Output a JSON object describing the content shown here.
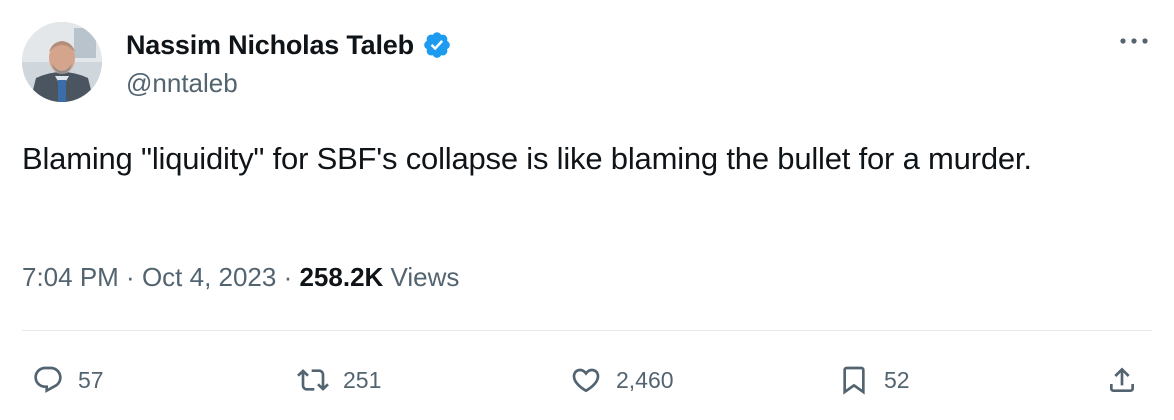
{
  "author": {
    "display_name": "Nassim Nicholas Taleb",
    "handle": "@nntaleb",
    "verified_icon": "verified-badge-icon",
    "avatar_icon": "avatar"
  },
  "tweet": {
    "text": "Blaming \"liquidity\" for SBF's collapse is like blaming the bullet for a murder.",
    "time": "7:04 PM",
    "sep1": " · ",
    "date": "Oct 4, 2023",
    "sep2": " · ",
    "views_count": "258.2K",
    "views_label": " Views"
  },
  "actions": {
    "replies": "57",
    "retweets": "251",
    "likes": "2,460",
    "bookmarks": "52"
  },
  "colors": {
    "text": "#0f1419",
    "secondary": "#536471",
    "verified": "#1d9bf0",
    "divider": "#e6e9ec"
  }
}
